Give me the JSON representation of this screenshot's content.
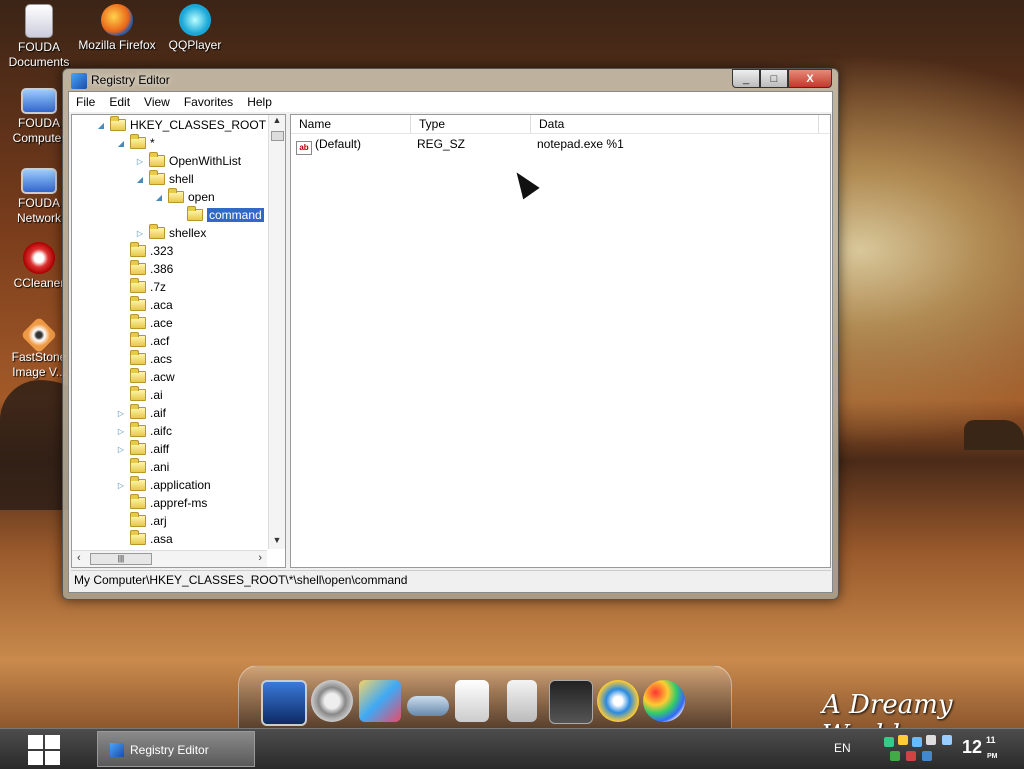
{
  "desktop": {
    "icons": [
      {
        "label": "FOUDA Documents"
      },
      {
        "label": "Mozilla Firefox"
      },
      {
        "label": "QQPlayer"
      },
      {
        "label": "FOUDA Computer"
      },
      {
        "label": "FOUDA Network"
      },
      {
        "label": "CCleaner"
      },
      {
        "label": "FastStone Image V..."
      }
    ],
    "watermark": "A Dreamy World"
  },
  "window": {
    "title": "Registry Editor",
    "controls": {
      "minimize": "_",
      "maximize": "□",
      "close": "X"
    },
    "menu": [
      "File",
      "Edit",
      "View",
      "Favorites",
      "Help"
    ],
    "tree": {
      "root": "HKEY_CLASSES_ROOT",
      "items": [
        {
          "label": "*"
        },
        {
          "label": "OpenWithList"
        },
        {
          "label": "shell"
        },
        {
          "label": "open"
        },
        {
          "label": "command"
        },
        {
          "label": "shellex"
        },
        {
          "label": ".323"
        },
        {
          "label": ".386"
        },
        {
          "label": ".7z"
        },
        {
          "label": ".aca"
        },
        {
          "label": ".ace"
        },
        {
          "label": ".acf"
        },
        {
          "label": ".acs"
        },
        {
          "label": ".acw"
        },
        {
          "label": ".ai"
        },
        {
          "label": ".aif"
        },
        {
          "label": ".aifc"
        },
        {
          "label": ".aiff"
        },
        {
          "label": ".ani"
        },
        {
          "label": ".application"
        },
        {
          "label": ".appref-ms"
        },
        {
          "label": ".arj"
        },
        {
          "label": ".asa"
        }
      ],
      "hscroll_thumb": "|||"
    },
    "list": {
      "columns": [
        "Name",
        "Type",
        "Data"
      ],
      "rows": [
        {
          "name": "(Default)",
          "type": "REG_SZ",
          "data": "notepad.exe %1",
          "icon": "ab"
        }
      ]
    },
    "status": "My Computer\\HKEY_CLASSES_ROOT\\*\\shell\\open\\command"
  },
  "taskbar": {
    "task_label": "Registry Editor",
    "language": "EN",
    "clock_hour": "12",
    "clock_min": "11",
    "clock_ampm": "PM"
  }
}
